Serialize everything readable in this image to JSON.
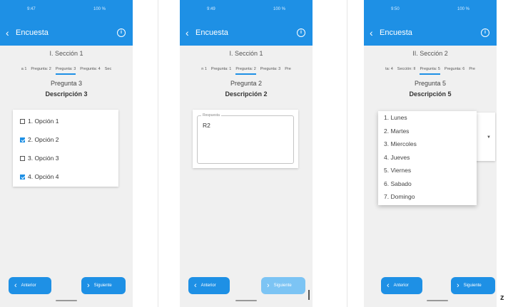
{
  "phone1": {
    "status": "9:47",
    "status_right": "100 %",
    "title": "Encuesta",
    "section": "I. Sección 1",
    "tabs": [
      "a 1",
      "Pregunta: 2",
      "Pregunta: 3",
      "Pregunta: 4",
      "Sec"
    ],
    "active_tab": 2,
    "question": "Pregunta 3",
    "description": "Descripción 3",
    "options": [
      {
        "label": "1. Opción 1",
        "checked": false
      },
      {
        "label": "2. Opción 2",
        "checked": true
      },
      {
        "label": "3. Opción 3",
        "checked": false
      },
      {
        "label": "4. Opción 4",
        "checked": true
      }
    ],
    "prev": "Anterior",
    "next": "Siguiente"
  },
  "phone2": {
    "status": "9:49",
    "status_right": "100 %",
    "title": "Encuesta",
    "section": "I. Sección 1",
    "tabs": [
      "n 1",
      "Pregunta: 1",
      "Pregunta: 2",
      "Pregunta: 3",
      "Pre"
    ],
    "active_tab": 2,
    "question": "Pregunta 2",
    "description": "Descripción 2",
    "field_label": "Respuesta",
    "field_value": "R2",
    "prev": "Anterior",
    "next": "Siguiente"
  },
  "phone3": {
    "status": "9:50",
    "status_right": "100 %",
    "title": "Encuesta",
    "section": "II. Sección 2",
    "tabs": [
      "ta: 4",
      "Sección: II",
      "Pregunta: 5",
      "Pregunta: 6",
      "Pre"
    ],
    "active_tab": 2,
    "question": "Pregunta 5",
    "description": "Descripción 5",
    "menu": [
      "1. Lunes",
      "2. Martes",
      "3. Miercoles",
      "4. Jueves",
      "5. Viernes",
      "6. Sabado",
      "7. Domingo"
    ],
    "prev": "Anterior",
    "next": "Siguiente"
  },
  "corner_label": "z",
  "colors": {
    "primary": "#1e90e5",
    "disabled": "#7cc4f4",
    "background": "#f0f0f0"
  }
}
